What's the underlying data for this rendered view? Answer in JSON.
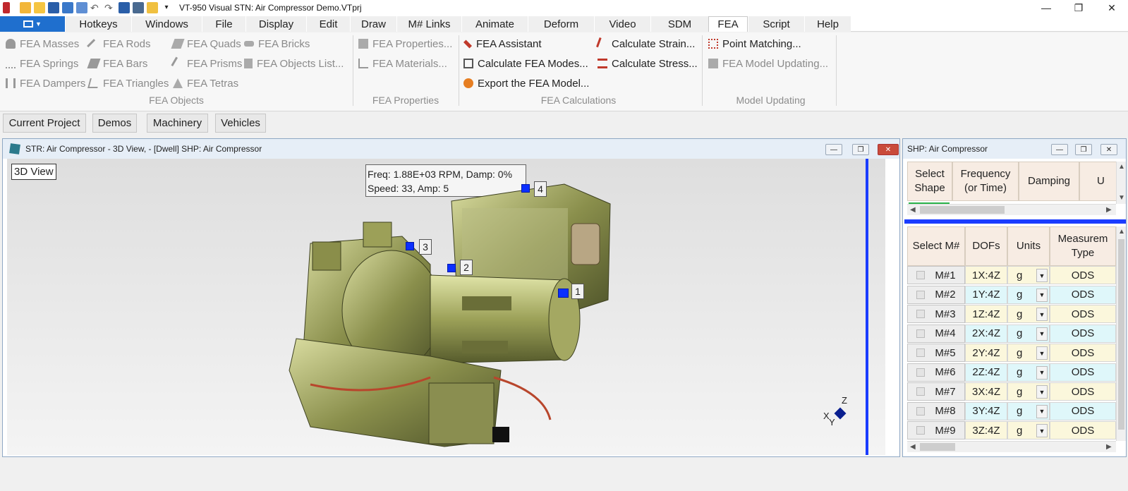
{
  "window": {
    "title": "VT-950 Visual STN: Air Compressor Demo.VTprj",
    "minimize": "—",
    "maximize": "❐",
    "close": "✕"
  },
  "menu_tabs": [
    {
      "label": "Hotkeys"
    },
    {
      "label": "Windows"
    },
    {
      "label": "File"
    },
    {
      "label": "Display"
    },
    {
      "label": "Edit"
    },
    {
      "label": "Draw"
    },
    {
      "label": "M# Links"
    },
    {
      "label": "Animate"
    },
    {
      "label": "Deform"
    },
    {
      "label": "Video"
    },
    {
      "label": "SDM"
    },
    {
      "label": "FEA"
    },
    {
      "label": "Script"
    },
    {
      "label": "Help"
    }
  ],
  "ribbon": {
    "fea_objects": {
      "label": "FEA Objects",
      "items": [
        "FEA Masses",
        "FEA Springs",
        "FEA Dampers",
        "FEA Rods",
        "FEA Bars",
        "FEA Triangles",
        "FEA Quads",
        "FEA Prisms",
        "FEA Tetras",
        "FEA Bricks",
        "FEA Objects List..."
      ]
    },
    "fea_properties": {
      "label": "FEA Properties",
      "items": [
        "FEA Properties...",
        "FEA Materials..."
      ]
    },
    "fea_calculations": {
      "label": "FEA Calculations",
      "items": [
        "FEA Assistant",
        "Calculate FEA Modes...",
        "Export the FEA Model...",
        "Calculate Strain...",
        "Calculate Stress..."
      ]
    },
    "model_updating": {
      "label": "Model Updating",
      "items": [
        "Point Matching...",
        "FEA Model Updating..."
      ]
    }
  },
  "project_buttons": [
    "Current Project",
    "Demos",
    "Machinery",
    "Vehicles"
  ],
  "str_window": {
    "title": "STR: Air Compressor - 3D View, - [Dwell] SHP: Air Compressor",
    "view_label": "3D View",
    "info_line1": "Freq: 1.88E+03 RPM, Damp: 0%",
    "info_line2": "Speed: 33, Amp: 5",
    "points": [
      "1",
      "2",
      "3",
      "4"
    ],
    "axis": {
      "z": "Z",
      "x": "X",
      "y": "Y"
    }
  },
  "shp_window": {
    "title": "SHP: Air Compressor",
    "shape_headers": [
      "Select Shape",
      "Frequency (or Time)",
      "Damping",
      "U"
    ],
    "m_headers": [
      "Select M#",
      "DOFs",
      "Units",
      "Measurem Type"
    ],
    "rows": [
      {
        "m": "M#1",
        "dof": "1X:4Z",
        "unit": "g",
        "type": "ODS"
      },
      {
        "m": "M#2",
        "dof": "1Y:4Z",
        "unit": "g",
        "type": "ODS"
      },
      {
        "m": "M#3",
        "dof": "1Z:4Z",
        "unit": "g",
        "type": "ODS"
      },
      {
        "m": "M#4",
        "dof": "2X:4Z",
        "unit": "g",
        "type": "ODS"
      },
      {
        "m": "M#5",
        "dof": "2Y:4Z",
        "unit": "g",
        "type": "ODS"
      },
      {
        "m": "M#6",
        "dof": "2Z:4Z",
        "unit": "g",
        "type": "ODS"
      },
      {
        "m": "M#7",
        "dof": "3X:4Z",
        "unit": "g",
        "type": "ODS"
      },
      {
        "m": "M#8",
        "dof": "3Y:4Z",
        "unit": "g",
        "type": "ODS"
      },
      {
        "m": "M#9",
        "dof": "3Z:4Z",
        "unit": "g",
        "type": "ODS"
      }
    ]
  },
  "colors": {
    "accent": "#1f6fce",
    "point_blue": "#0b2fff",
    "row_yellow": "#fbf7dc",
    "row_cyan": "#dff7fa",
    "header": "#f7ece3"
  }
}
